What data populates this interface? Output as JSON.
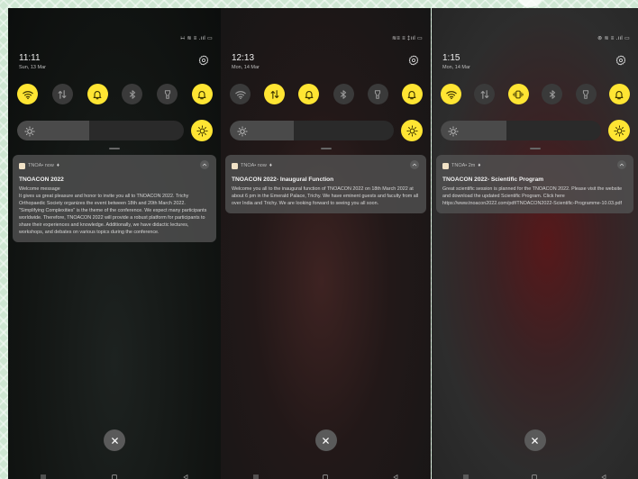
{
  "screens": [
    {
      "status_icons": "∺ ≋ ≡ .ııl ▭",
      "time": "11:11",
      "date": "Sun, 13 Mar",
      "quick_tiles": [
        {
          "icon": "wifi-icon",
          "active": true
        },
        {
          "icon": "mobile-data-icon",
          "active": false
        },
        {
          "icon": "bell-icon",
          "active": true
        },
        {
          "icon": "bluetooth-icon",
          "active": false
        },
        {
          "icon": "flashlight-icon",
          "active": false
        },
        {
          "icon": "ringer-icon",
          "active": true
        }
      ],
      "brightness_percent": 43,
      "notification": {
        "app": "TNOA",
        "meta": " • now",
        "title": "TNOACON 2022",
        "body": [
          "Welcome message",
          "It gives us great pleasure and honor to invite you all to TNOACON 2022. Trichy Orthopaedic Society organizes the event between 18th and 20th March 2022. \"Simplifying Complexities\" is the theme of the conference. We expect many participants worldwide. Therefore, TNOACON 2022 will provide a robust platform for participants to share their experiences and knowledge. Additionally, we have didactic lectures, workshops, and debates on various topics during the conference."
        ]
      }
    },
    {
      "status_icons": "≋≡ ≡ ‡ııl ▭",
      "time": "12:13",
      "date": "Mon, 14 Mar",
      "quick_tiles": [
        {
          "icon": "wifi-icon",
          "active": false
        },
        {
          "icon": "mobile-data-icon",
          "active": true
        },
        {
          "icon": "bell-icon",
          "active": true
        },
        {
          "icon": "bluetooth-icon",
          "active": false
        },
        {
          "icon": "flashlight-icon",
          "active": false
        },
        {
          "icon": "ringer-icon",
          "active": true
        }
      ],
      "brightness_percent": 39,
      "notification": {
        "app": "TNOA",
        "meta": " • now",
        "title": "TNOACON 2022- Inaugural Function",
        "body": [
          "Welcome you all to the inaugural function of TNOACON 2022 on 18th March 2022 at about 6 pm in the Emerald Palace, Trichy. We have eminent guests and faculty from all over India and Trichy. We are looking forward to seeing you all soon."
        ]
      }
    },
    {
      "status_icons": "⊚ ≋ ≡ .ııl ▭",
      "time": "1:15",
      "date": "Mon, 14 Mar",
      "quick_tiles": [
        {
          "icon": "wifi-icon",
          "active": true
        },
        {
          "icon": "mobile-data-icon",
          "active": false
        },
        {
          "icon": "vibrate-icon",
          "active": true
        },
        {
          "icon": "bluetooth-icon",
          "active": false
        },
        {
          "icon": "flashlight-icon",
          "active": false
        },
        {
          "icon": "ringer-icon",
          "active": true
        }
      ],
      "brightness_percent": 41,
      "notification": {
        "app": "TNOA",
        "meta": " • 2m",
        "title": "TNOACON 2022- Scientific Program",
        "body": [
          "Great scientific session is planned for the TNOACON 2022. Please visit the website and download the updated Scientific Program. Click here https://www.tnoacon2022.com/pdf/TNOACON2022-Scientific-Programme-10.03.pdf"
        ]
      }
    }
  ],
  "colors": {
    "tile_active": "#ffe533",
    "tile_inactive": "#3a3a3a",
    "card": "#505050"
  }
}
